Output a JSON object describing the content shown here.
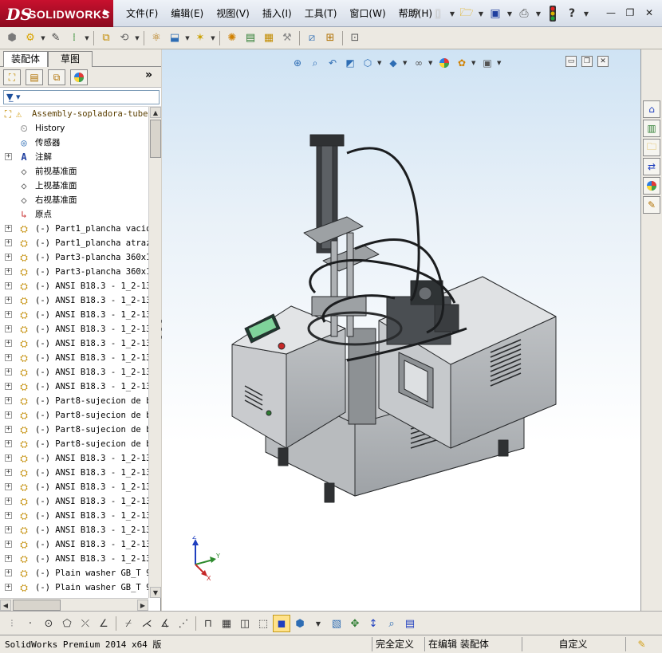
{
  "titlebar": {
    "brand": "SOLIDWORKS",
    "brand_mark": "DS",
    "menus": [
      "文件(F)",
      "编辑(E)",
      "视图(V)",
      "插入(I)",
      "工具(T)",
      "窗口(W)",
      "帮助(H)"
    ],
    "quick_access_icons": [
      "new-document-icon",
      "open-icon",
      "save-icon",
      "print-icon",
      "traffic-light-icon",
      "help-icon"
    ],
    "window_controls": [
      "minimize-icon",
      "restore-icon",
      "close-icon"
    ]
  },
  "toolbar": {
    "icons": [
      "rebuild-icon",
      "options-icon",
      "edit-component-icon",
      "insert-components-icon",
      "mate-icon",
      "linear-pattern-icon",
      "smart-fasteners-icon",
      "move-component-icon",
      "show-hidden-icon",
      "assembly-features-icon",
      "reference-geometry-icon",
      "new-motion-study-icon",
      "bill-of-materials-icon",
      "exploded-view-icon",
      "explode-line-icon",
      "interference-icon",
      "clearance-icon",
      "hole-alignment-icon"
    ]
  },
  "leftpanel": {
    "tabs": [
      "装配体",
      "草图"
    ],
    "filter_placeholder": "",
    "tree": {
      "root": "Assembly-sopladora-tube",
      "fixed": [
        {
          "icon": "history-icon",
          "label": "History"
        },
        {
          "icon": "sensor-icon",
          "label": "传感器"
        },
        {
          "icon": "annotation-icon",
          "label": "注解"
        },
        {
          "icon": "plane-icon",
          "label": "前视基准面"
        },
        {
          "icon": "plane-icon",
          "label": "上视基准面"
        },
        {
          "icon": "plane-icon",
          "label": "右视基准面"
        },
        {
          "icon": "origin-icon",
          "label": "原点"
        }
      ],
      "components": [
        "(-) Part1_plancha vacio<",
        "(-) Part1_plancha atraz<",
        "(-) Part3-plancha 360x13",
        "(-) Part3-plancha 360x13",
        "(-) ANSI B18.3 - 1_2-13",
        "(-) ANSI B18.3 - 1_2-13",
        "(-) ANSI B18.3 - 1_2-13",
        "(-) ANSI B18.3 - 1_2-13",
        "(-) ANSI B18.3 - 1_2-13",
        "(-) ANSI B18.3 - 1_2-13",
        "(-) ANSI B18.3 - 1_2-13",
        "(-) ANSI B18.3 - 1_2-13",
        "(-) Part8-sujecion de be",
        "(-) Part8-sujecion de be",
        "(-) Part8-sujecion de be",
        "(-) Part8-sujecion de be",
        "(-) ANSI B18.3 - 1_2-13",
        "(-) ANSI B18.3 - 1_2-13",
        "(-) ANSI B18.3 - 1_2-13",
        "(-) ANSI B18.3 - 1_2-13",
        "(-) ANSI B18.3 - 1_2-13",
        "(-) ANSI B18.3 - 1_2-13",
        "(-) ANSI B18.3 - 1_2-13",
        "(-) ANSI B18.3 - 1_2-13",
        "(-) Plain washer GB_T 97",
        "(-) Plain washer GB_T 97",
        "(-) Plain washer GB_T 97"
      ]
    }
  },
  "viewport": {
    "headsup_icons": [
      "zoom-to-fit-icon",
      "zoom-to-area-icon",
      "previous-view-icon",
      "section-view-icon",
      "view-orientation-icon",
      "display-style-icon",
      "hide-show-items-icon",
      "edit-appearance-icon",
      "apply-scene-icon",
      "view-settings-icon"
    ],
    "triad_axes": [
      "Z",
      "Y",
      "X"
    ]
  },
  "taskpane": {
    "icons": [
      "solidworks-resources-icon",
      "design-library-icon",
      "file-explorer-icon",
      "view-palette-icon",
      "appearances-icon",
      "custom-properties-icon"
    ]
  },
  "bottombar": {
    "icons": [
      "point-icon",
      "circle-icon",
      "polygon-icon",
      "line-icon",
      "trim-icon",
      "mirror-icon",
      "extend-icon",
      "dimension-icon",
      "grid-icon",
      "measure-icon",
      "wireframe-icon",
      "shaded-icon",
      "display-icon",
      "component-icon",
      "move-icon",
      "rotate-icon",
      "table-icon"
    ]
  },
  "statusbar": {
    "app": "SolidWorks Premium 2014 x64 版",
    "field1": "完全定义",
    "field2": "在编辑 装配体",
    "field3": "自定义",
    "field4_icon": "tooltip-icon"
  },
  "colors": {
    "brand_red": "#c8102e",
    "machine_body": "#c4c6c8",
    "machine_dark": "#3a3d40",
    "viewport_top": "#cfe3f4"
  }
}
